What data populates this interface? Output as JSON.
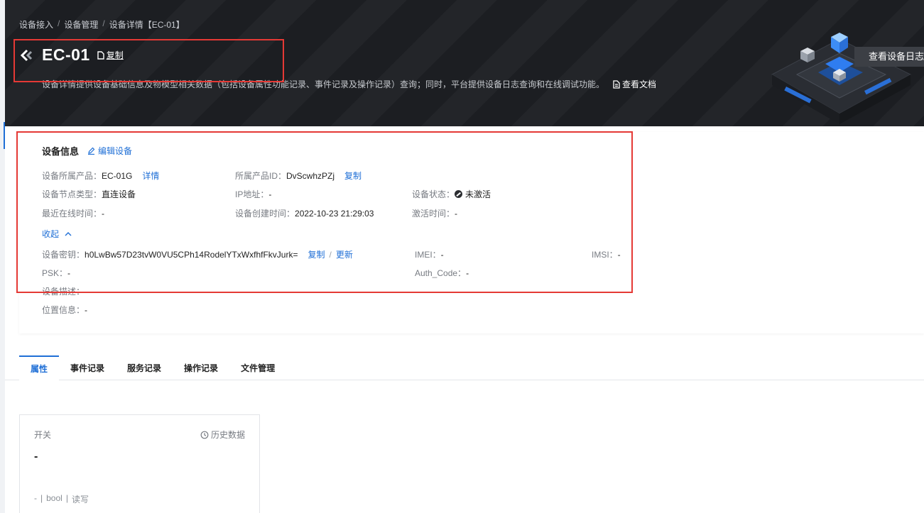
{
  "breadcrumb": [
    "设备接入",
    "设备管理",
    "设备详情【EC-01】"
  ],
  "header": {
    "title": "EC-01",
    "copy_label": "复制",
    "description": "设备详情提供设备基础信息及物模型相关数据（包括设备属性功能记录、事件记录及操作记录）查询；同时，平台提供设备日志查询和在线调试功能。",
    "doc_link": "查看文档",
    "log_button": "查看设备日志"
  },
  "device_info": {
    "title": "设备信息",
    "edit_label": "编辑设备",
    "product_label": "设备所属产品：",
    "product_value": "EC-01G",
    "product_detail_link": "详情",
    "product_id_label": "所属产品ID：",
    "product_id_value": "DvScwhzPZj",
    "product_id_copy": "复制",
    "node_type_label": "设备节点类型：",
    "node_type_value": "直连设备",
    "ip_label": "IP地址：",
    "ip_value": "-",
    "status_label": "设备状态：",
    "status_value": "未激活",
    "last_online_label": "最近在线时间：",
    "last_online_value": "-",
    "created_label": "设备创建时间：",
    "created_value": "2022-10-23 21:29:03",
    "activated_label": "激活时间：",
    "activated_value": "-",
    "collapse_label": "收起",
    "secret_label": "设备密钥：",
    "secret_value": "h0LwBw57D23tvW0VU5CPh14RodelYTxWxfhfFkvJurk=",
    "secret_copy": "复制",
    "secret_sep": "/",
    "secret_update": "更新",
    "imei_label": "IMEI：",
    "imei_value": "-",
    "imsi_label": "IMSI：",
    "imsi_value": "-",
    "psk_label": "PSK：",
    "psk_value": "-",
    "auth_label": "Auth_Code：",
    "auth_value": "-",
    "desc_label": "设备描述：",
    "desc_value": "-",
    "location_label": "位置信息：",
    "location_value": "-"
  },
  "tabs": [
    "属性",
    "事件记录",
    "服务记录",
    "操作记录",
    "文件管理"
  ],
  "property_card": {
    "name": "开关",
    "history_label": "历史数据",
    "value": "-",
    "meta": [
      "-",
      "|",
      "bool",
      "|",
      "读写"
    ]
  },
  "colors": {
    "accent": "#1f6fd6",
    "header_bg": "#1e2024",
    "highlight": "#e53935"
  },
  "icons": [
    "back-chevron-icon",
    "copy-icon",
    "doc-icon",
    "edit-icon",
    "chevron-up-icon",
    "status-dot-icon",
    "history-icon"
  ]
}
